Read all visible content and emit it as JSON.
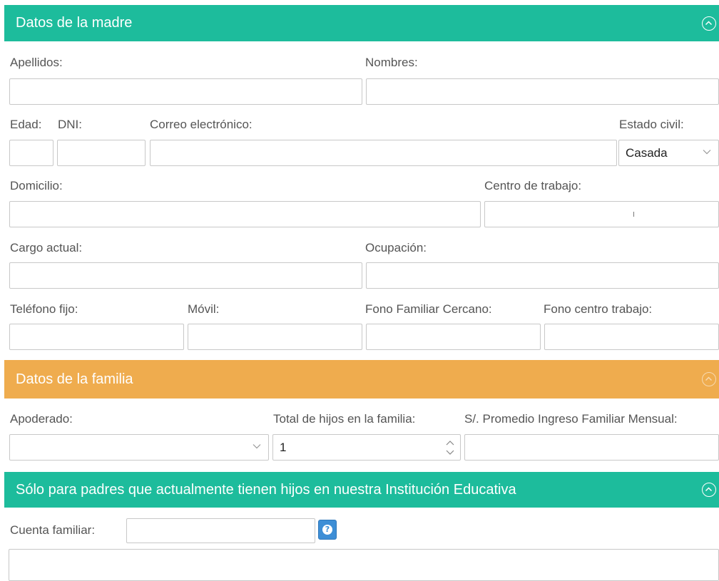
{
  "madre": {
    "title": "Datos de la madre",
    "apellidos_label": "Apellidos:",
    "nombres_label": "Nombres:",
    "edad_label": "Edad:",
    "dni_label": "DNI:",
    "correo_label": "Correo electrónico:",
    "estado_civil_label": "Estado civil:",
    "estado_civil_value": "Casada",
    "domicilio_label": "Domicilio:",
    "centro_trabajo_label": "Centro de trabajo:",
    "cargo_label": "Cargo actual:",
    "ocupacion_label": "Ocupación:",
    "telefono_label": "Teléfono fijo:",
    "movil_label": "Móvil:",
    "fono_familiar_label": "Fono Familiar Cercano:",
    "fono_trabajo_label": "Fono centro trabajo:"
  },
  "familia": {
    "title": "Datos de la familia",
    "apoderado_label": "Apoderado:",
    "apoderado_value": "",
    "total_hijos_label": "Total de hijos en la familia:",
    "total_hijos_value": "1",
    "ingreso_label": "S/. Promedio Ingreso Familiar Mensual:"
  },
  "padres": {
    "title": "Sólo para padres que actualmente tienen hijos en nuestra Institución Educativa",
    "cuenta_label": "Cuenta familiar:"
  },
  "icons": {
    "collapse": "chevron-up-circle-icon",
    "dropdown": "chevron-down-icon",
    "spinner": "spinner-arrows-icon",
    "help": "question-circle-icon"
  },
  "colors": {
    "green_header": "#1dbc9c",
    "orange_header": "#efac4e",
    "help_button": "#3d8ed6"
  }
}
